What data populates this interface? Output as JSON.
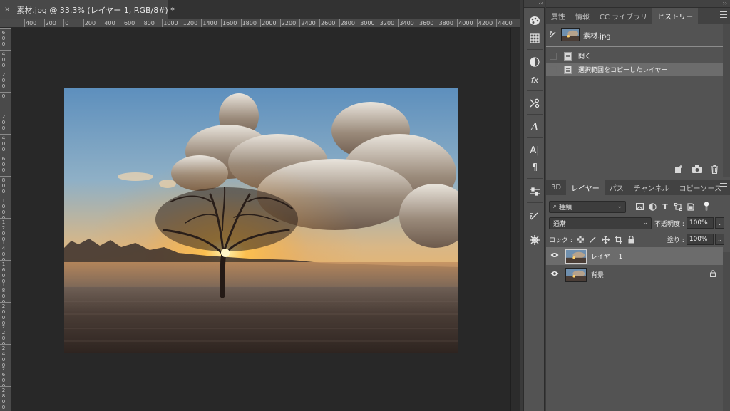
{
  "document": {
    "tab_close": "×",
    "tab_title": "素材.jpg @ 33.3% (レイヤー 1, RGB/8#) *"
  },
  "ruler": {
    "horizontal_labels": [
      "400",
      "200",
      "0",
      "200",
      "400",
      "600",
      "800",
      "1000",
      "1200",
      "1400",
      "1600",
      "1800",
      "2000",
      "2200",
      "2400",
      "2600",
      "2800",
      "3000",
      "3200",
      "3400",
      "3600",
      "3800",
      "4000",
      "4200",
      "4400"
    ],
    "vertical_labels": [
      "6 0 0",
      "4 0 0",
      "2 0 0",
      "0",
      "2 0 0",
      "4 0 0",
      "6 0 0",
      "8 0 0",
      "1 0 0 0",
      "1 2 0 0",
      "1 4 0 0",
      "1 6 0 0",
      "1 8 0 0",
      "2 0 0 0",
      "2 2 0 0",
      "2 4 0 0",
      "2 6 0 0",
      "2 8 0 0"
    ]
  },
  "strip": {
    "collapse": "‹‹",
    "icons": [
      "palette-icon",
      "grid-swatches-icon",
      "adjustment-icon",
      "fx-icon",
      "brush-settings-icon",
      "glyphs-icon",
      "character-icon",
      "paragraph-icon",
      "properties-sliders-icon",
      "brush-presets-icon",
      "navigator-icon"
    ]
  },
  "top_panel": {
    "collapse": "››",
    "tabs": [
      {
        "label": "属性",
        "active": false
      },
      {
        "label": "情報",
        "active": false
      },
      {
        "label": "CC ライブラリ",
        "active": false
      },
      {
        "label": "ヒストリー",
        "active": true
      }
    ]
  },
  "history": {
    "snapshot_name": "素材.jpg",
    "states": [
      {
        "label": "開く",
        "selected": false
      },
      {
        "label": "選択範囲をコピーしたレイヤー",
        "selected": true
      }
    ],
    "footer_icons": [
      "new-document-from-state-icon",
      "camera-snapshot-icon",
      "trash-icon"
    ]
  },
  "layers_panel": {
    "tabs": [
      {
        "label": "3D",
        "active": false
      },
      {
        "label": "レイヤー",
        "active": true
      },
      {
        "label": "パス",
        "active": false
      },
      {
        "label": "チャンネル",
        "active": false
      },
      {
        "label": "コピーソース",
        "active": false
      }
    ],
    "filter_kind": "種類",
    "filter_prefix": "⌕",
    "blend_mode": "通常",
    "opacity_label": "不透明度 :",
    "opacity_value": "100%",
    "lock_label": "ロック :",
    "fill_label": "塗り :",
    "fill_value": "100%",
    "layers": [
      {
        "name": "レイヤー 1",
        "selected": true,
        "locked": false
      },
      {
        "name": "背景",
        "selected": false,
        "locked": true
      }
    ]
  },
  "colors": {
    "canvas_bg": "#282828",
    "panel_bg": "#535353",
    "selected_row": "#6c6c6c"
  }
}
